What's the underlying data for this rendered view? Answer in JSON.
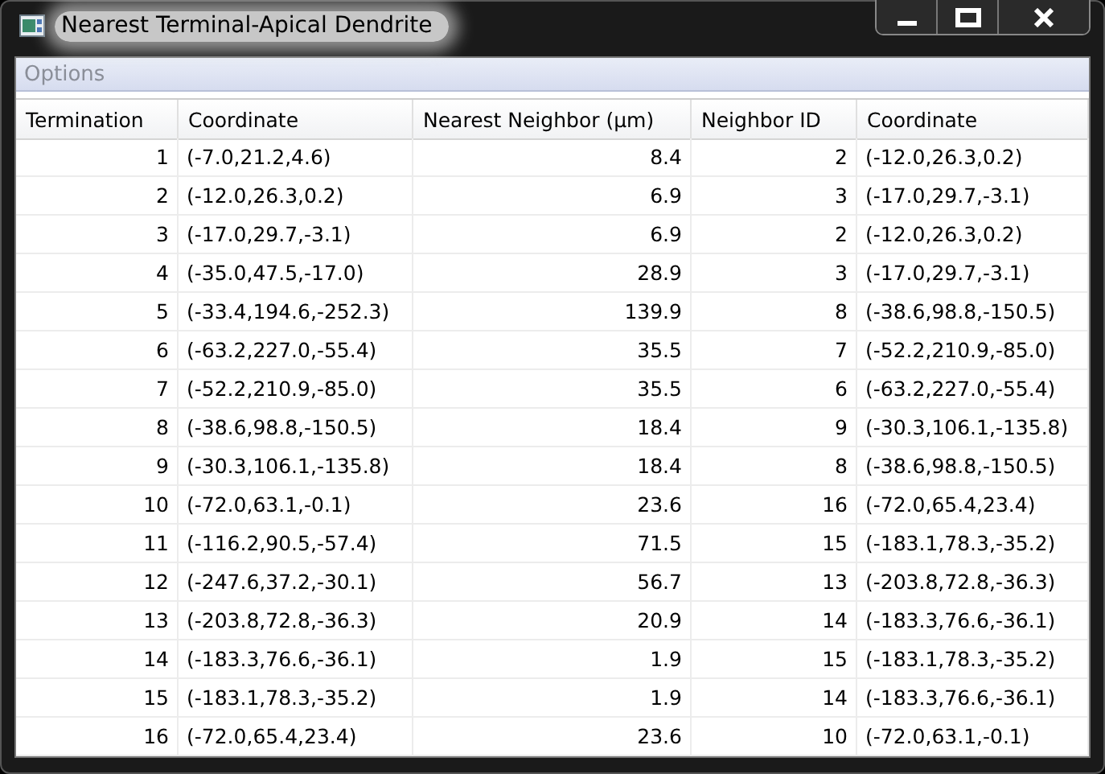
{
  "window": {
    "title": "Nearest Terminal-Apical Dendrite"
  },
  "menu": [
    {
      "label": "Options"
    }
  ],
  "table": {
    "columns": [
      "Termination",
      "Coordinate",
      "Nearest Neighbor (µm)",
      "Neighbor ID",
      "Coordinate"
    ],
    "rows": [
      [
        "1",
        "(-7.0,21.2,4.6)",
        "8.4",
        "2",
        "(-12.0,26.3,0.2)"
      ],
      [
        "2",
        "(-12.0,26.3,0.2)",
        "6.9",
        "3",
        "(-17.0,29.7,-3.1)"
      ],
      [
        "3",
        "(-17.0,29.7,-3.1)",
        "6.9",
        "2",
        "(-12.0,26.3,0.2)"
      ],
      [
        "4",
        "(-35.0,47.5,-17.0)",
        "28.9",
        "3",
        "(-17.0,29.7,-3.1)"
      ],
      [
        "5",
        "(-33.4,194.6,-252.3)",
        "139.9",
        "8",
        "(-38.6,98.8,-150.5)"
      ],
      [
        "6",
        "(-63.2,227.0,-55.4)",
        "35.5",
        "7",
        "(-52.2,210.9,-85.0)"
      ],
      [
        "7",
        "(-52.2,210.9,-85.0)",
        "35.5",
        "6",
        "(-63.2,227.0,-55.4)"
      ],
      [
        "8",
        "(-38.6,98.8,-150.5)",
        "18.4",
        "9",
        "(-30.3,106.1,-135.8)"
      ],
      [
        "9",
        "(-30.3,106.1,-135.8)",
        "18.4",
        "8",
        "(-38.6,98.8,-150.5)"
      ],
      [
        "10",
        "(-72.0,63.1,-0.1)",
        "23.6",
        "16",
        "(-72.0,65.4,23.4)"
      ],
      [
        "11",
        "(-116.2,90.5,-57.4)",
        "71.5",
        "15",
        "(-183.1,78.3,-35.2)"
      ],
      [
        "12",
        "(-247.6,37.2,-30.1)",
        "56.7",
        "13",
        "(-203.8,72.8,-36.3)"
      ],
      [
        "13",
        "(-203.8,72.8,-36.3)",
        "20.9",
        "14",
        "(-183.3,76.6,-36.1)"
      ],
      [
        "14",
        "(-183.3,76.6,-36.1)",
        "1.9",
        "15",
        "(-183.1,78.3,-35.2)"
      ],
      [
        "15",
        "(-183.1,78.3,-35.2)",
        "1.9",
        "14",
        "(-183.3,76.6,-36.1)"
      ],
      [
        "16",
        "(-72.0,65.4,23.4)",
        "23.6",
        "10",
        "(-72.0,63.1,-0.1)"
      ]
    ]
  }
}
